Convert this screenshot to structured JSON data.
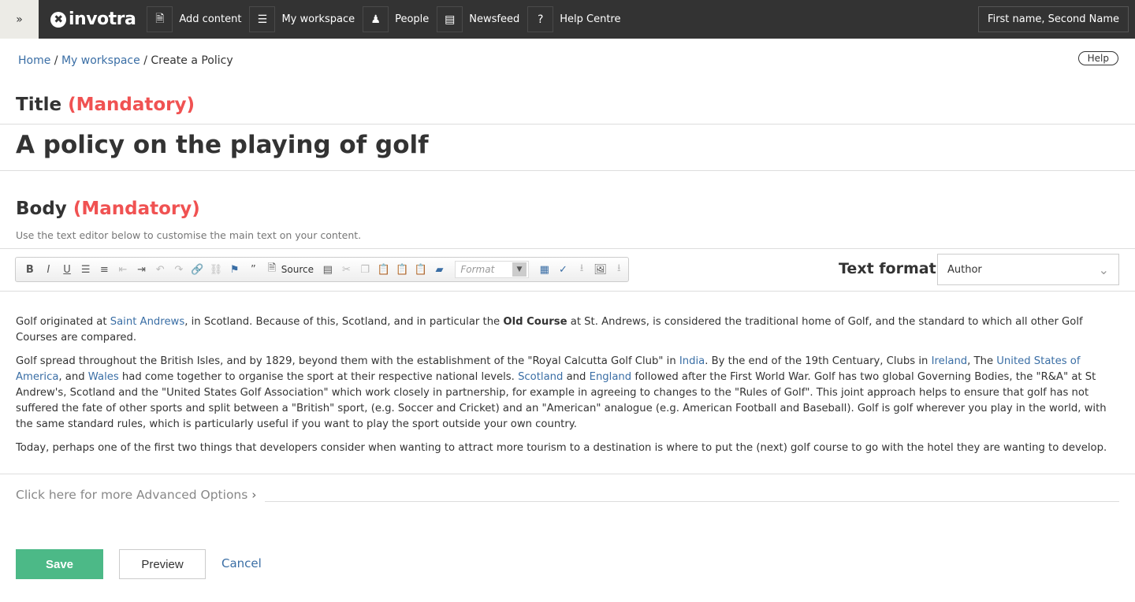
{
  "nav": {
    "brand": "invotra",
    "items": [
      {
        "label": "Add content",
        "icon": "document-icon"
      },
      {
        "label": "My workspace",
        "icon": "list-icon"
      },
      {
        "label": "People",
        "icon": "people-icon"
      },
      {
        "label": "Newsfeed",
        "icon": "newspaper-icon"
      },
      {
        "label": "Help Centre",
        "icon": "question-icon"
      }
    ],
    "user": "First name, Second Name"
  },
  "breadcrumb": {
    "home": "Home",
    "workspace": "My workspace",
    "current": "Create a Policy",
    "sep": "/"
  },
  "help": "Help",
  "title": {
    "label": "Title",
    "mandatory": "(Mandatory)",
    "value": "A policy on the playing of golf"
  },
  "body": {
    "label": "Body",
    "mandatory": "(Mandatory)",
    "hint": "Use the text editor below to customise the main text on your content."
  },
  "editor": {
    "source_label": "Source",
    "format_placeholder": "Format"
  },
  "text_format": {
    "label": "Text format",
    "value": "Author"
  },
  "content": {
    "p1": [
      "Golf originated at ",
      "Saint Andrews",
      ", in Scotland. Because of this, Scotland, and in particular the ",
      "Old Course",
      " at St. Andrews, is considered the traditional home of Golf, and the standard to which all other Golf Courses are compared."
    ],
    "p2": [
      "Golf spread throughout the British Isles, and by 1829, beyond them with the establishment of the \"Royal Calcutta Golf Club\" in ",
      "India",
      ". By the end of the 19th Centuary, Clubs in ",
      "Ireland",
      ", The ",
      "United States of America",
      ", and ",
      "Wales",
      " had come together to organise the sport at their respective national levels. ",
      "Scotland",
      " and ",
      "England",
      " followed after the First World War. Golf has two global Governing Bodies, the \"R&A\" at St Andrew's, Scotland and the \"United States Golf Association\" which work closely in partnership, for example in agreeing to changes to the \"Rules of Golf\". This joint approach helps to ensure that golf has not suffered the fate of other sports and split between a \"British\" sport, (e.g. Soccer and Cricket) and an \"American\" analogue (e.g. American Football and Baseball). Golf is golf wherever you play in the world, with the same standard rules, which is particularly useful if you want to play the sport outside your own country."
    ],
    "p3": "Today, perhaps one of the first two things that developers consider when wanting to attract more tourism to a destination is where to put the (next) golf course to go with the hotel they are wanting to develop."
  },
  "advanced": "Click here for more Advanced Options",
  "buttons": {
    "save": "Save",
    "preview": "Preview",
    "cancel": "Cancel"
  },
  "colors": {
    "nav": "#333333",
    "mandatory": "#f05252",
    "link": "#3a6ea5",
    "save": "#4cb987"
  }
}
